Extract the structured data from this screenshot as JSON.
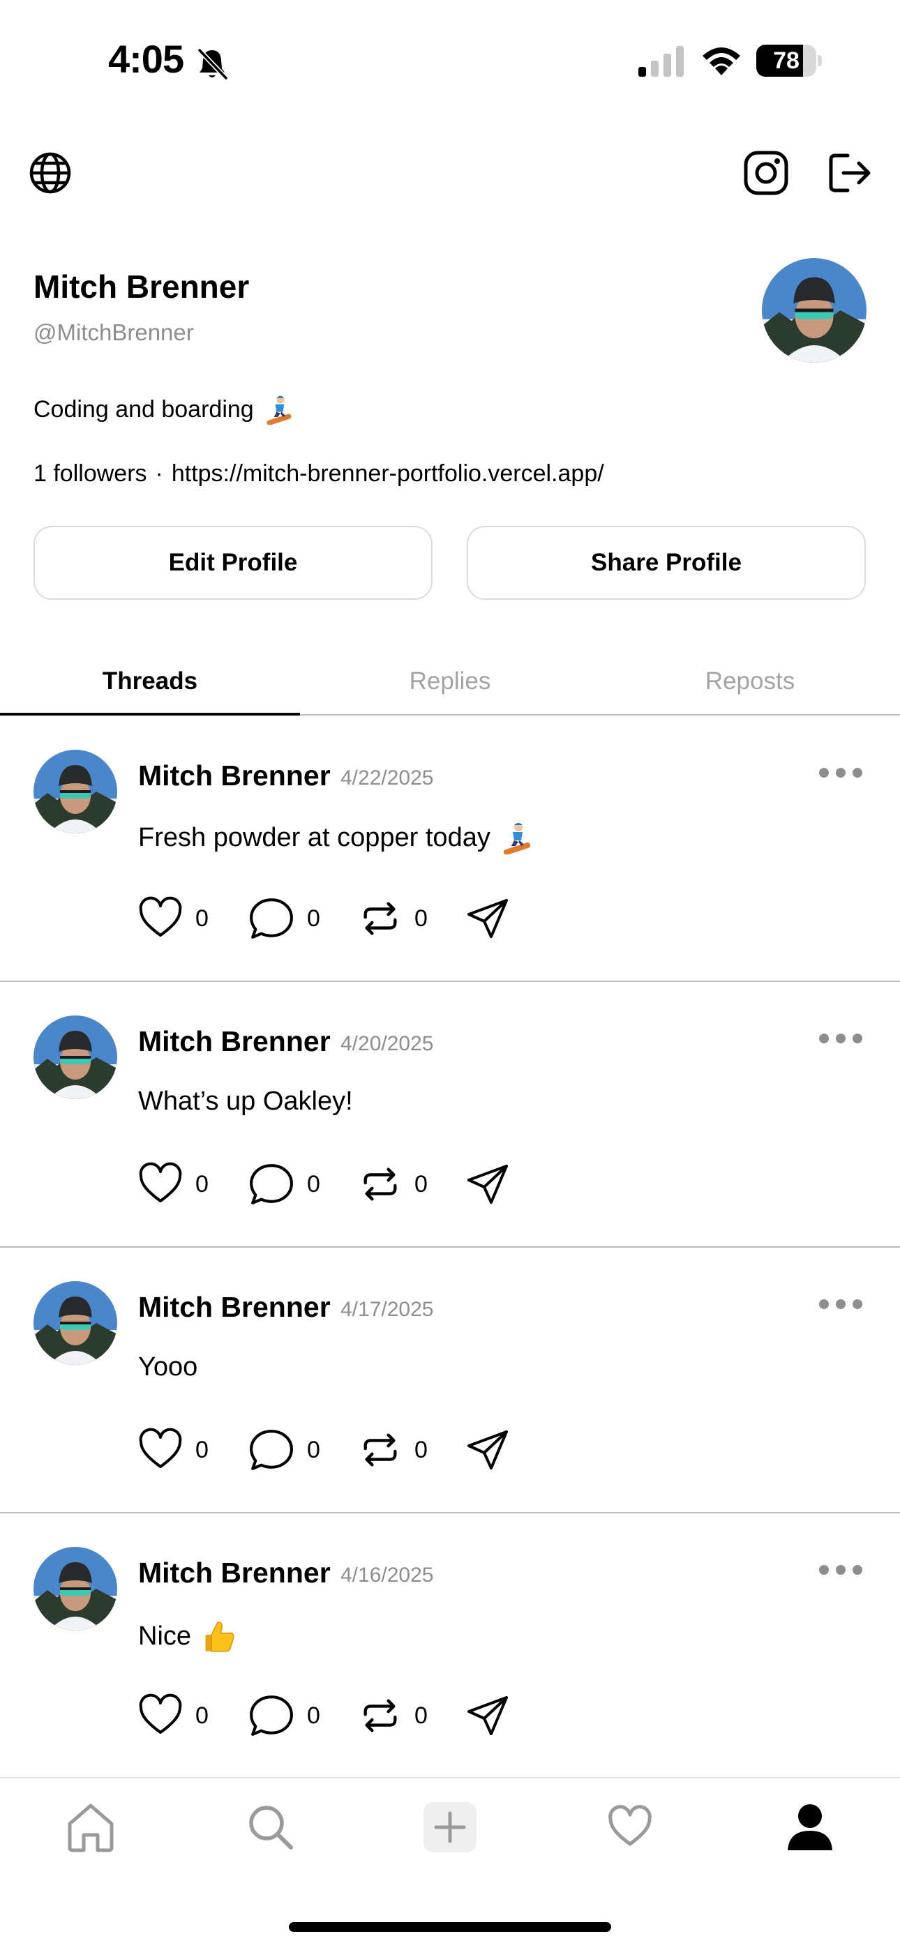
{
  "status_bar": {
    "time": "4:05",
    "battery_level": "78",
    "battery_fraction": 0.78,
    "icons": [
      "bell-slash-icon",
      "cellular-signal-icon",
      "wifi-icon",
      "battery-icon"
    ]
  },
  "toolbar": {
    "icons": [
      "globe-icon",
      "instagram-icon",
      "logout-icon"
    ]
  },
  "profile": {
    "name": "Mitch Brenner",
    "handle": "@MitchBrenner",
    "bio": "Coding and boarding",
    "bio_emoji": "snowboarder-emoji",
    "followers": "1 followers",
    "separator": "·",
    "website": "https://mitch-brenner-portfolio.vercel.app/",
    "edit_label": "Edit Profile",
    "share_label": "Share Profile"
  },
  "tabs": [
    {
      "label": "Threads",
      "active": true
    },
    {
      "label": "Replies",
      "active": false
    },
    {
      "label": "Reposts",
      "active": false
    }
  ],
  "posts": [
    {
      "author": "Mitch Brenner",
      "date": "4/22/2025",
      "text": "Fresh powder at copper today",
      "emoji": "snowboarder-emoji",
      "likes": "0",
      "comments": "0",
      "reposts": "0"
    },
    {
      "author": "Mitch Brenner",
      "date": "4/20/2025",
      "text": "What’s up Oakley!",
      "emoji": "",
      "likes": "0",
      "comments": "0",
      "reposts": "0"
    },
    {
      "author": "Mitch Brenner",
      "date": "4/17/2025",
      "text": "Yooo",
      "emoji": "",
      "likes": "0",
      "comments": "0",
      "reposts": "0"
    },
    {
      "author": "Mitch Brenner",
      "date": "4/16/2025",
      "text": "Nice",
      "emoji": "thumbs-up-emoji",
      "likes": "0",
      "comments": "0",
      "reposts": "0"
    }
  ],
  "bottom_nav": {
    "items": [
      "home-icon",
      "search-icon",
      "new-thread-icon",
      "activity-heart-icon",
      "profile-icon"
    ],
    "active": "profile-icon"
  },
  "colors": {
    "text": "#000000",
    "muted": "#8e8e8e",
    "tab_inactive": "#a3a3a3",
    "divider": "#bdbdbd",
    "button_border": "#dcdcdc",
    "nav_inactive": "#9a9a9a"
  }
}
